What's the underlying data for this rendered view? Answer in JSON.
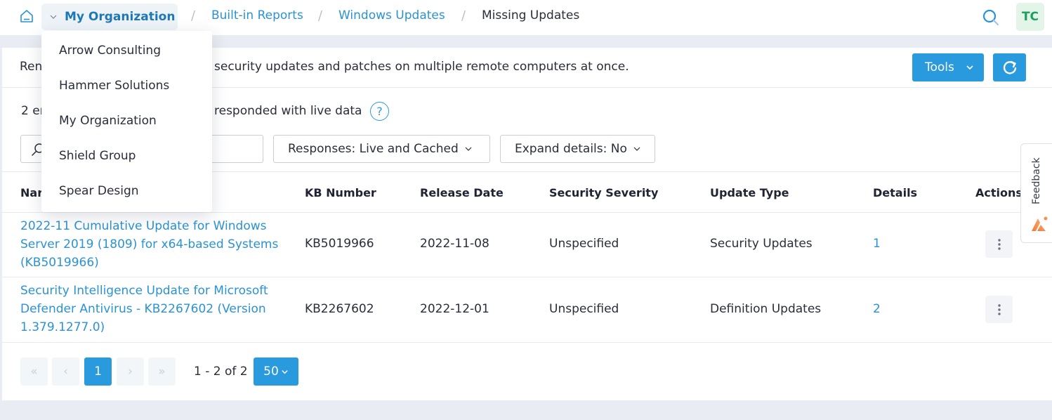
{
  "breadcrumb": {
    "org": "My Organization",
    "items": [
      {
        "label": "Built-in Reports"
      },
      {
        "label": "Windows Updates"
      },
      {
        "label": "Missing Updates"
      }
    ],
    "separator": "/"
  },
  "header": {
    "avatar_initials": "TC"
  },
  "org_dropdown": {
    "options": [
      "Arrow Consulting",
      "Hammer Solutions",
      "My Organization",
      "Shield Group",
      "Spear Design"
    ]
  },
  "description": "Remotely install security updates and patches on multiple remote computers at once.",
  "description_visible_left": "Ren",
  "description_visible_right": "security updates and patches on multiple remote computers at once.",
  "toolbar": {
    "tools_label": "Tools"
  },
  "summary": {
    "left": "2 er",
    "right": "responded with live data",
    "help": "?"
  },
  "search": {
    "placeholder": "",
    "value": ""
  },
  "filters": {
    "responses": "Responses: Live and Cached",
    "expand": "Expand details: No"
  },
  "table": {
    "columns": [
      "Nar",
      "KB Number",
      "Release Date",
      "Security Severity",
      "Update Type",
      "Details",
      "Actions"
    ],
    "rows": [
      {
        "name": "2022-11 Cumulative Update for Windows Server 2019 (1809) for x64-based Systems (KB5019966)",
        "kb": "KB5019966",
        "date": "2022-11-08",
        "severity": "Unspecified",
        "type": "Security Updates",
        "details": "1"
      },
      {
        "name": "Security Intelligence Update for Microsoft Defender Antivirus - KB2267602 (Version 1.379.1277.0)",
        "kb": "KB2267602",
        "date": "2022-12-01",
        "severity": "Unspecified",
        "type": "Definition Updates",
        "details": "2"
      }
    ]
  },
  "pagination": {
    "first": "«",
    "prev": "‹",
    "current": "1",
    "next": "›",
    "last": "»",
    "range": "1 - 2 of 2",
    "per_page": "50"
  },
  "feedback": {
    "label": "Feedback"
  },
  "colors": {
    "accent": "#2a9ade",
    "link": "#2a92d6",
    "avatar_bg": "#e3f4e9",
    "avatar_text": "#17a35b"
  }
}
